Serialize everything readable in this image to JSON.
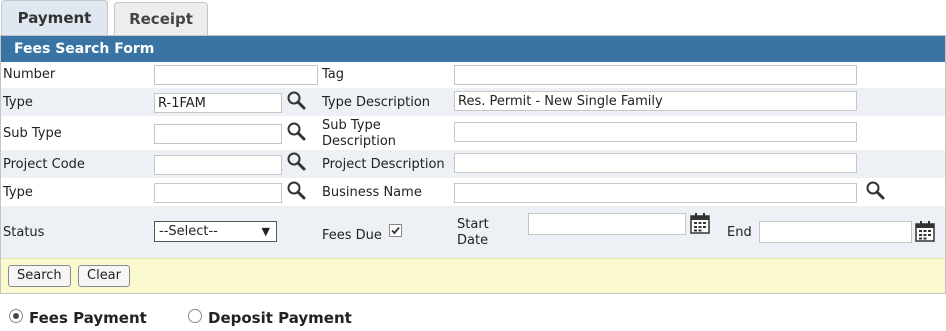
{
  "tabs": [
    {
      "label": "Payment",
      "active": true
    },
    {
      "label": "Receipt",
      "active": false
    }
  ],
  "form": {
    "title": "Fees Search Form",
    "number_label": "Number",
    "number_value": "",
    "tag_label": "Tag",
    "tag_value": "",
    "type_label": "Type",
    "type_value": "R-1FAM",
    "type_description_label": "Type Description",
    "type_description_value": "Res. Permit - New Single Family",
    "sub_type_label": "Sub Type",
    "sub_type_value": "",
    "sub_type_description_label_1": "Sub Type",
    "sub_type_description_label_2": "Description",
    "sub_type_description_value": "",
    "project_code_label": "Project Code",
    "project_code_value": "",
    "project_description_label": "Project Description",
    "project_description_value": "",
    "type2_label": "Type",
    "type2_value": "",
    "business_name_label": "Business Name",
    "business_name_value": "",
    "status_label": "Status",
    "status_selected": "--Select--",
    "fees_due_label": "Fees Due",
    "fees_due_checked": true,
    "start_date_label_1": "Start",
    "start_date_label_2": "Date",
    "start_date_value": "",
    "end_label": "End",
    "end_value": ""
  },
  "actions": {
    "search_label": "Search",
    "clear_label": "Clear"
  },
  "payment_mode": {
    "options": [
      {
        "label": "Fees Payment",
        "selected": true
      },
      {
        "label": "Deposit Payment",
        "selected": false
      }
    ]
  },
  "icons": {
    "lookup": "magnifier-icon",
    "date": "calendar-icon",
    "dropdown": "caret-down-icon"
  },
  "colors": {
    "header_bg": "#3a74a5",
    "row_alt_bg": "#edf0f4",
    "footer_bg": "#fbf9cf",
    "active_tab_bg": "#dfe8f1"
  }
}
